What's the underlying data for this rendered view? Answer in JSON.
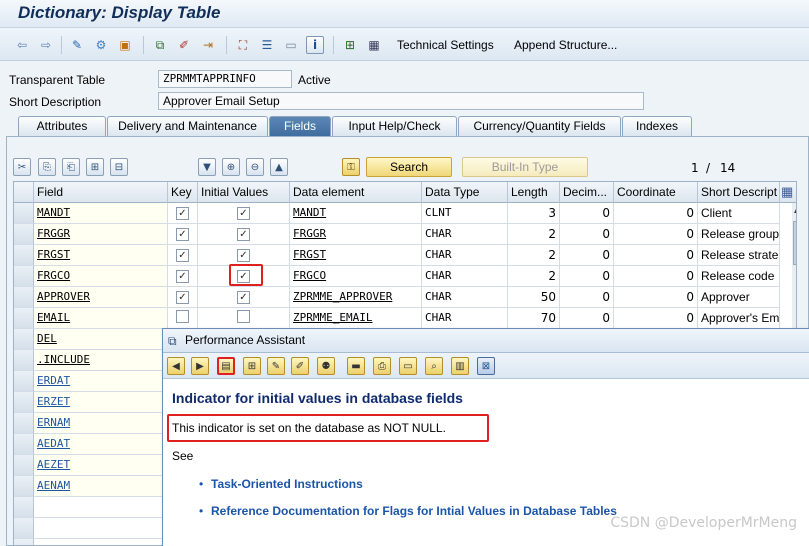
{
  "window": {
    "title": "Dictionary: Display Table"
  },
  "toolbar": {
    "technical_settings": "Technical Settings",
    "append_structure": "Append Structure..."
  },
  "header": {
    "table_type_label": "Transparent Table",
    "table_name": "ZPRMMTAPPRINFO",
    "status": "Active",
    "short_desc_label": "Short Description",
    "short_desc": "Approver Email Setup"
  },
  "tabs": [
    {
      "label": "Attributes"
    },
    {
      "label": "Delivery and Maintenance"
    },
    {
      "label": "Fields"
    },
    {
      "label": "Input Help/Check"
    },
    {
      "label": "Currency/Quantity Fields"
    },
    {
      "label": "Indexes"
    }
  ],
  "fields_toolbar": {
    "search_label": "Search",
    "builtin_label": "Built-In Type",
    "page_current": "1",
    "page_sep": "/",
    "page_total": "14"
  },
  "grid": {
    "columns": [
      "Field",
      "Key",
      "Initial Values",
      "Data element",
      "Data Type",
      "Length",
      "Decim...",
      "Coordinate",
      "Short Descript"
    ],
    "rows": [
      {
        "field": "MANDT",
        "key": true,
        "init": true,
        "element": "MANDT",
        "type": "CLNT",
        "length": "3",
        "dec": "0",
        "coord": "0",
        "desc": "Client"
      },
      {
        "field": "FRGGR",
        "key": true,
        "init": true,
        "element": "FRGGR",
        "type": "CHAR",
        "length": "2",
        "dec": "0",
        "coord": "0",
        "desc": "Release group"
      },
      {
        "field": "FRGST",
        "key": true,
        "init": true,
        "element": "FRGST",
        "type": "CHAR",
        "length": "2",
        "dec": "0",
        "coord": "0",
        "desc": "Release strate"
      },
      {
        "field": "FRGCO",
        "key": true,
        "init": true,
        "element": "FRGCO",
        "type": "CHAR",
        "length": "2",
        "dec": "0",
        "coord": "0",
        "desc": "Release code"
      },
      {
        "field": "APPROVER",
        "key": true,
        "init": true,
        "element": "ZPRMME_APPROVER",
        "type": "CHAR",
        "length": "50",
        "dec": "0",
        "coord": "0",
        "desc": "Approver"
      },
      {
        "field": "EMAIL",
        "key": false,
        "init": false,
        "element": "ZPRMME_EMAIL",
        "type": "CHAR",
        "length": "70",
        "dec": "0",
        "coord": "0",
        "desc": "Approver's Em"
      }
    ],
    "extra_fields": [
      "DEL",
      ".INCLUDE",
      "ERDAT",
      "ERZET",
      "ERNAM",
      "AEDAT",
      "AEZET",
      "AENAM"
    ]
  },
  "assistant": {
    "title": "Performance Assistant",
    "heading": "Indicator for initial values in database fields",
    "body": "This indicator is set on the database as NOT NULL.",
    "see": "See",
    "links": [
      "Task-Oriented Instructions",
      "Reference Documentation for Flags for Intial Values in Database Tables"
    ]
  },
  "watermark": "CSDN @DeveloperMrMeng",
  "colors": {
    "accent": "#3e6c9e",
    "highlight": "#e02020",
    "link": "#1b55a8",
    "heading": "#102a6e"
  }
}
